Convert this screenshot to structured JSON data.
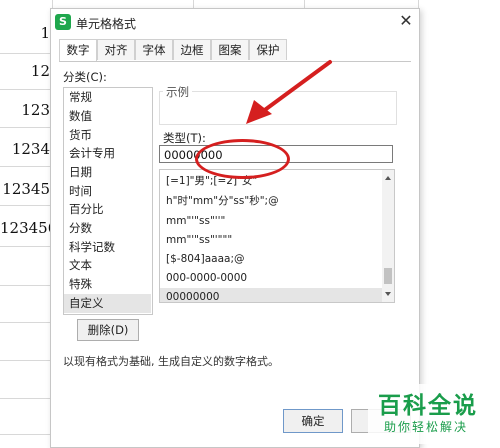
{
  "sheet": {
    "cells": [
      "1",
      "12",
      "123",
      "1234",
      "12345",
      "123456"
    ]
  },
  "dialog": {
    "title": "单元格格式",
    "app_icon_letter": "S",
    "close_glyph": "✕",
    "tabs": [
      "数字",
      "对齐",
      "字体",
      "边框",
      "图案",
      "保护"
    ],
    "active_tab": "数字",
    "category_label": "分类(C):",
    "categories": [
      "常规",
      "数值",
      "货币",
      "会计专用",
      "日期",
      "时间",
      "百分比",
      "分数",
      "科学记数",
      "文本",
      "特殊",
      "自定义"
    ],
    "selected_category": "自定义",
    "sample_label": "示例",
    "type_label": "类型(T):",
    "type_value": "00000000",
    "formats": [
      "[=1]\"男\";[=2]\"女\"",
      "h\"时\"mm\"分\"ss\"秒\";@",
      "mm\"'\"ss\"''\"",
      "mm\"'\"ss\"'\"\"\"",
      "[$-804]aaaa;@",
      "000-0000-0000",
      "00000000"
    ],
    "selected_format": "00000000",
    "delete_button": "删除(D)",
    "hint": "以现有格式为基础, 生成自定义的数字格式。",
    "ok_button": "确定"
  },
  "watermark": {
    "title": "百科全说",
    "subtitle": "助你轻松解决"
  },
  "colors": {
    "annotation_red": "#d51f1f",
    "app_icon_green": "#1fa74d",
    "watermark_green": "#1a9d4b"
  }
}
